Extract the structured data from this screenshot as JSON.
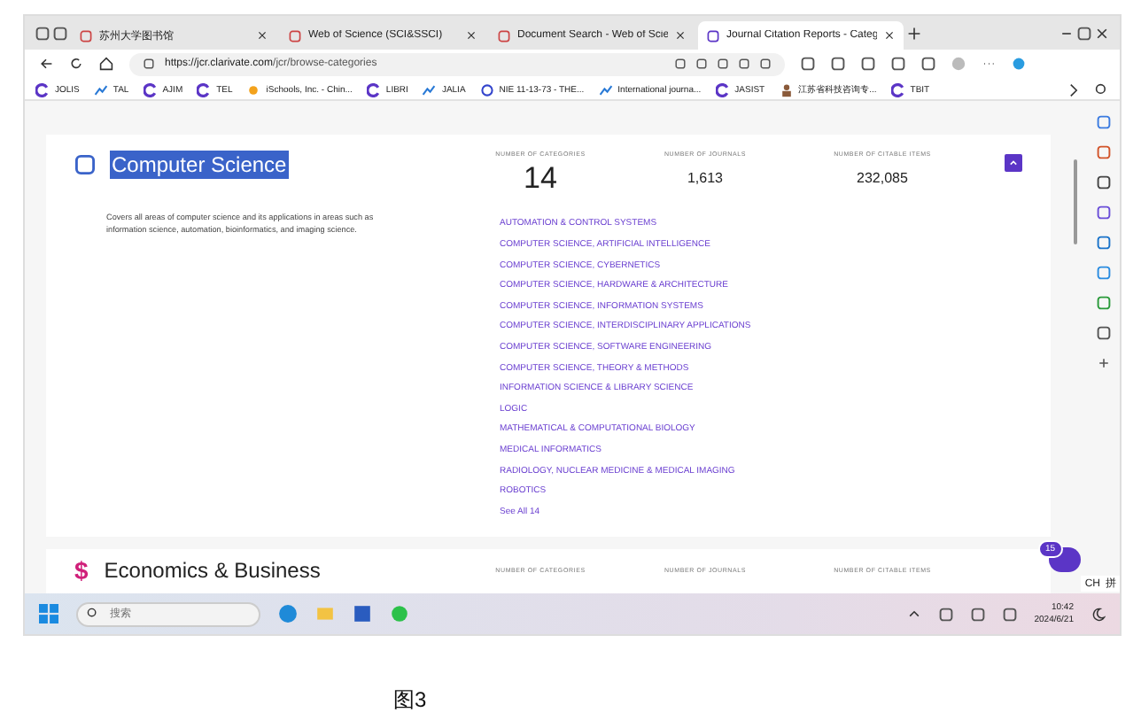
{
  "browser": {
    "tabs": [
      {
        "title": "苏州大学图书馆",
        "selected": false
      },
      {
        "title": "Web of Science (SCI&SSCI)",
        "selected": false
      },
      {
        "title": "Document Search - Web of Scie",
        "selected": false
      },
      {
        "title": "Journal Citation Reports - Categ",
        "selected": true
      }
    ],
    "url": {
      "host": "https://jcr.clarivate.com",
      "path": "/jcr/browse-categories"
    },
    "bookmarks": [
      {
        "label": "JOLIS",
        "kind": "clarivate"
      },
      {
        "label": "TAL",
        "kind": "chart"
      },
      {
        "label": "AJIM",
        "kind": "clarivate"
      },
      {
        "label": "TEL",
        "kind": "clarivate"
      },
      {
        "label": "iSchools, Inc. - Chin...",
        "kind": "sun"
      },
      {
        "label": "LIBRI",
        "kind": "clarivate"
      },
      {
        "label": "JALIA",
        "kind": "chart"
      },
      {
        "label": "NIE 11-13-73 - THE...",
        "kind": "globe"
      },
      {
        "label": "International journa...",
        "kind": "chart"
      },
      {
        "label": "JASIST",
        "kind": "clarivate"
      },
      {
        "label": "江苏省科技咨询专...",
        "kind": "person"
      },
      {
        "label": "TBIT",
        "kind": "clarivate"
      }
    ]
  },
  "category": {
    "title": "Computer Science",
    "highlighted": true,
    "description": "Covers all areas of computer science and its applications in areas such as information science, automation, bioinformatics, and imaging science.",
    "stats": [
      {
        "label": "NUMBER OF CATEGORIES",
        "value": "14",
        "kind": "large"
      },
      {
        "label": "NUMBER OF JOURNALS",
        "value": "1,613",
        "kind": "small"
      },
      {
        "label": "NUMBER OF CITABLE ITEMS",
        "value": "232,085",
        "kind": "small"
      }
    ],
    "expanded": true,
    "links": [
      "AUTOMATION & CONTROL SYSTEMS",
      "COMPUTER SCIENCE, ARTIFICIAL INTELLIGENCE",
      "COMPUTER SCIENCE, CYBERNETICS",
      "COMPUTER SCIENCE, HARDWARE & ARCHITECTURE",
      "COMPUTER SCIENCE, INFORMATION SYSTEMS",
      "COMPUTER SCIENCE, INTERDISCIPLINARY APPLICATIONS",
      "COMPUTER SCIENCE, SOFTWARE ENGINEERING",
      "COMPUTER SCIENCE, THEORY & METHODS",
      "INFORMATION SCIENCE & LIBRARY SCIENCE",
      "LOGIC",
      "MATHEMATICAL & COMPUTATIONAL BIOLOGY",
      "MEDICAL INFORMATICS",
      "RADIOLOGY, NUCLEAR MEDICINE & MEDICAL IMAGING",
      "ROBOTICS"
    ],
    "see_all": "See All 14"
  },
  "next_category": {
    "symbol": "$",
    "title": "Economics & Business",
    "stat_labels": [
      "NUMBER OF CATEGORIES",
      "NUMBER OF JOURNALS",
      "NUMBER OF CITABLE ITEMS"
    ]
  },
  "chat_badge": "15",
  "ime": {
    "language": "CH",
    "mode": "拼"
  },
  "taskbar": {
    "search": {
      "placeholder": "搜索"
    },
    "time": "10:42",
    "date": "2024/6/21"
  },
  "caption": "图3"
}
